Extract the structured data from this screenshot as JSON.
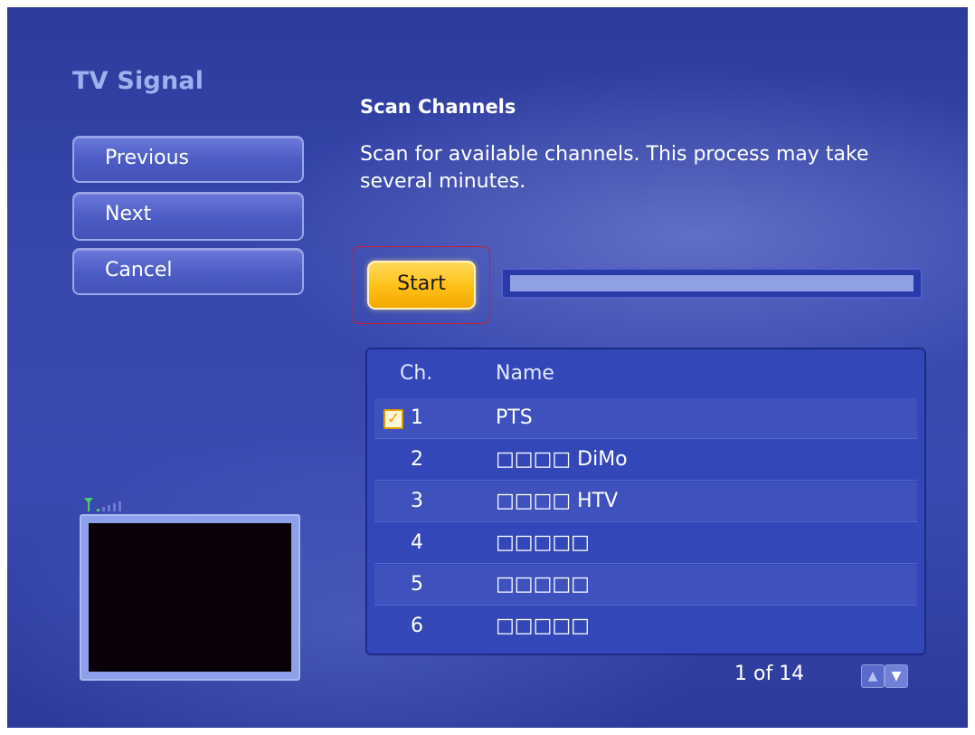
{
  "page": {
    "title": "TV Signal"
  },
  "nav": {
    "previous_label": "Previous",
    "next_label": "Next",
    "cancel_label": "Cancel"
  },
  "scan": {
    "title": "Scan Channels",
    "description": "Scan for available channels. This process may take several minutes.",
    "start_label": "Start",
    "progress": 0
  },
  "list": {
    "header_ch": "Ch.",
    "header_name": "Name",
    "rows": [
      {
        "ch": "1",
        "name": "PTS",
        "checked": true
      },
      {
        "ch": "2",
        "name": "□□□□ DiMo",
        "checked": false
      },
      {
        "ch": "3",
        "name": "□□□□ HTV",
        "checked": false
      },
      {
        "ch": "4",
        "name": "□□□□□",
        "checked": false
      },
      {
        "ch": "5",
        "name": "□□□□□",
        "checked": false
      },
      {
        "ch": "6",
        "name": "□□□□□",
        "checked": false
      }
    ],
    "check_glyph": "✓"
  },
  "pager": {
    "text": "1 of 14",
    "up_icon": "chevron-up-icon",
    "down_icon": "chevron-down-icon"
  },
  "signal": {
    "icon": "antenna-signal-icon"
  },
  "colors": {
    "background": "#3747ac",
    "accent_button": "#ffc21a",
    "title": "#9fb0ee",
    "focus_outline": "#d11a2a"
  }
}
